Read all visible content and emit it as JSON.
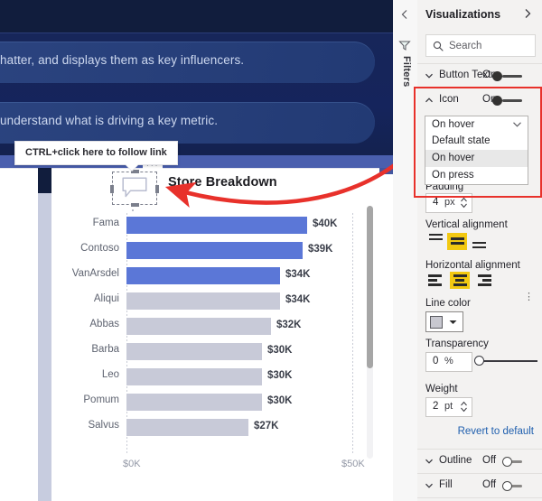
{
  "canvas": {
    "bubbles": [
      {
        "text": "hatter, and displays them as key influencers."
      },
      {
        "text": "understand what is driving a key metric."
      }
    ],
    "tooltip": "CTRL+click here to follow link",
    "card_ellipsis": "···",
    "visual_title": "Store Breakdown",
    "icon_name": "speech-bubble-icon"
  },
  "chart_data": {
    "type": "bar",
    "orientation": "horizontal",
    "title": "Store Breakdown",
    "xlabel": "",
    "ylabel": "",
    "xlim": [
      0,
      50
    ],
    "xticks": [
      "$0K",
      "$50K"
    ],
    "grid": true,
    "categories": [
      "Fama",
      "Contoso",
      "VanArsdel",
      "Aliqui",
      "Abbas",
      "Barba",
      "Leo",
      "Pomum",
      "Salvus"
    ],
    "values": [
      40,
      39,
      34,
      34,
      32,
      30,
      30,
      30,
      27
    ],
    "labels": [
      "$40K",
      "$39K",
      "$34K",
      "$34K",
      "$32K",
      "$30K",
      "$30K",
      "$30K",
      "$27K"
    ],
    "highlighted": [
      true,
      true,
      true,
      false,
      false,
      false,
      false,
      false,
      false
    ],
    "colors": {
      "highlight": "#5b77d7",
      "muted": "#c8cad8"
    }
  },
  "rail": {
    "collapse_icon": "chevron-left-icon",
    "filter_icon": "filter-icon",
    "label": "Filters"
  },
  "pane": {
    "title": "Visualizations",
    "collapse_icon": "chevron-right-icon",
    "search": {
      "placeholder": "Search",
      "icon": "search-icon"
    },
    "sections": [
      {
        "name": "Button Text",
        "state": "On",
        "expanded": false
      },
      {
        "name": "Icon",
        "state": "On",
        "expanded": true
      },
      {
        "name": "Outline",
        "state": "Off",
        "expanded": false
      },
      {
        "name": "Fill",
        "state": "Off",
        "expanded": false
      }
    ],
    "icon_section": {
      "dropdown": {
        "value": "On hover",
        "options": [
          "Default state",
          "On hover",
          "On press"
        ],
        "selected_index": 1
      },
      "padding": {
        "label": "Padding",
        "value": "4",
        "unit": "px"
      },
      "vertical_alignment": {
        "label": "Vertical alignment",
        "selected": 1
      },
      "horizontal_alignment": {
        "label": "Horizontal alignment",
        "selected": 1
      },
      "line_color": {
        "label": "Line color",
        "swatch": "#c8c8d0"
      },
      "transparency": {
        "label": "Transparency",
        "value": "0",
        "unit": "%"
      },
      "weight": {
        "label": "Weight",
        "value": "2",
        "unit": "pt"
      },
      "revert": "Revert to default"
    }
  },
  "colors": {
    "accent_red": "#e8312b",
    "navy": "#111d3d",
    "bar_blue": "#5b77d7",
    "yellow": "#f2c811",
    "link_blue": "#1f5fae"
  }
}
